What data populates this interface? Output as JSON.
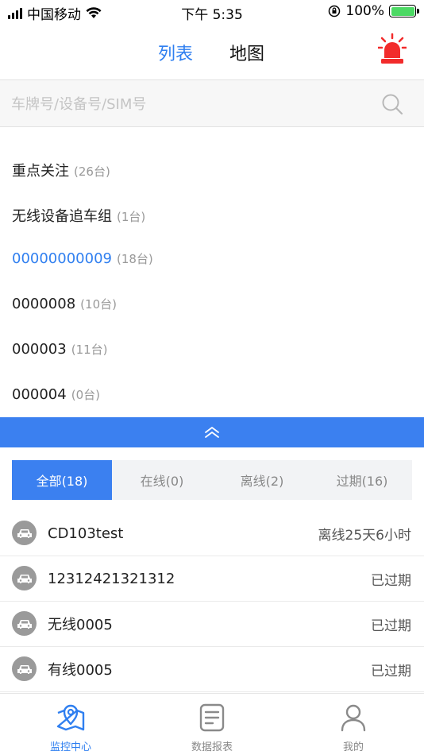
{
  "status_bar": {
    "carrier": "中国移动",
    "time": "下午 5:35",
    "battery": "100%"
  },
  "header": {
    "tab_list": "列表",
    "tab_map": "地图"
  },
  "search": {
    "placeholder": "车牌号/设备号/SIM号"
  },
  "groups": [
    {
      "name": "重点关注",
      "count": "(26台)"
    },
    {
      "name": "无线设备追车组",
      "count": "(1台)"
    },
    {
      "name": "00000000009",
      "count": "(18台)"
    },
    {
      "name": "0000008",
      "count": "(10台)"
    },
    {
      "name": "000003",
      "count": "(11台)"
    },
    {
      "name": "000004",
      "count": "(0台)"
    }
  ],
  "filter_tabs": [
    {
      "label": "全部(18)"
    },
    {
      "label": "在线(0)"
    },
    {
      "label": "离线(2)"
    },
    {
      "label": "过期(16)"
    }
  ],
  "vehicles": [
    {
      "plate": "CD103test",
      "status": "离线25天6小时"
    },
    {
      "plate": "12312421321312",
      "status": "已过期"
    },
    {
      "plate": "无线0005",
      "status": "已过期"
    },
    {
      "plate": "有线0005",
      "status": "已过期"
    }
  ],
  "nav": [
    {
      "label": "监控中心",
      "icon": "map-location-icon"
    },
    {
      "label": "数据报表",
      "icon": "report-document-icon"
    },
    {
      "label": "我的",
      "icon": "user-icon"
    }
  ],
  "colors": {
    "accent": "#2f7ff0",
    "bar": "#3b80f0",
    "alarm": "#f22b2b"
  }
}
